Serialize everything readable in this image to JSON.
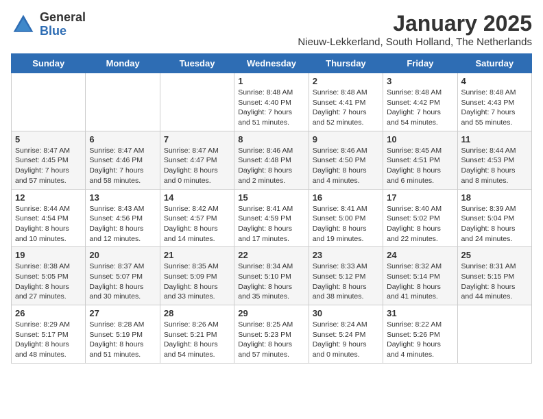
{
  "logo": {
    "general": "General",
    "blue": "Blue"
  },
  "title": "January 2025",
  "subtitle": "Nieuw-Lekkerland, South Holland, The Netherlands",
  "weekdays": [
    "Sunday",
    "Monday",
    "Tuesday",
    "Wednesday",
    "Thursday",
    "Friday",
    "Saturday"
  ],
  "weeks": [
    [
      {
        "day": "",
        "info": ""
      },
      {
        "day": "",
        "info": ""
      },
      {
        "day": "",
        "info": ""
      },
      {
        "day": "1",
        "info": "Sunrise: 8:48 AM\nSunset: 4:40 PM\nDaylight: 7 hours and 51 minutes."
      },
      {
        "day": "2",
        "info": "Sunrise: 8:48 AM\nSunset: 4:41 PM\nDaylight: 7 hours and 52 minutes."
      },
      {
        "day": "3",
        "info": "Sunrise: 8:48 AM\nSunset: 4:42 PM\nDaylight: 7 hours and 54 minutes."
      },
      {
        "day": "4",
        "info": "Sunrise: 8:48 AM\nSunset: 4:43 PM\nDaylight: 7 hours and 55 minutes."
      }
    ],
    [
      {
        "day": "5",
        "info": "Sunrise: 8:47 AM\nSunset: 4:45 PM\nDaylight: 7 hours and 57 minutes."
      },
      {
        "day": "6",
        "info": "Sunrise: 8:47 AM\nSunset: 4:46 PM\nDaylight: 7 hours and 58 minutes."
      },
      {
        "day": "7",
        "info": "Sunrise: 8:47 AM\nSunset: 4:47 PM\nDaylight: 8 hours and 0 minutes."
      },
      {
        "day": "8",
        "info": "Sunrise: 8:46 AM\nSunset: 4:48 PM\nDaylight: 8 hours and 2 minutes."
      },
      {
        "day": "9",
        "info": "Sunrise: 8:46 AM\nSunset: 4:50 PM\nDaylight: 8 hours and 4 minutes."
      },
      {
        "day": "10",
        "info": "Sunrise: 8:45 AM\nSunset: 4:51 PM\nDaylight: 8 hours and 6 minutes."
      },
      {
        "day": "11",
        "info": "Sunrise: 8:44 AM\nSunset: 4:53 PM\nDaylight: 8 hours and 8 minutes."
      }
    ],
    [
      {
        "day": "12",
        "info": "Sunrise: 8:44 AM\nSunset: 4:54 PM\nDaylight: 8 hours and 10 minutes."
      },
      {
        "day": "13",
        "info": "Sunrise: 8:43 AM\nSunset: 4:56 PM\nDaylight: 8 hours and 12 minutes."
      },
      {
        "day": "14",
        "info": "Sunrise: 8:42 AM\nSunset: 4:57 PM\nDaylight: 8 hours and 14 minutes."
      },
      {
        "day": "15",
        "info": "Sunrise: 8:41 AM\nSunset: 4:59 PM\nDaylight: 8 hours and 17 minutes."
      },
      {
        "day": "16",
        "info": "Sunrise: 8:41 AM\nSunset: 5:00 PM\nDaylight: 8 hours and 19 minutes."
      },
      {
        "day": "17",
        "info": "Sunrise: 8:40 AM\nSunset: 5:02 PM\nDaylight: 8 hours and 22 minutes."
      },
      {
        "day": "18",
        "info": "Sunrise: 8:39 AM\nSunset: 5:04 PM\nDaylight: 8 hours and 24 minutes."
      }
    ],
    [
      {
        "day": "19",
        "info": "Sunrise: 8:38 AM\nSunset: 5:05 PM\nDaylight: 8 hours and 27 minutes."
      },
      {
        "day": "20",
        "info": "Sunrise: 8:37 AM\nSunset: 5:07 PM\nDaylight: 8 hours and 30 minutes."
      },
      {
        "day": "21",
        "info": "Sunrise: 8:35 AM\nSunset: 5:09 PM\nDaylight: 8 hours and 33 minutes."
      },
      {
        "day": "22",
        "info": "Sunrise: 8:34 AM\nSunset: 5:10 PM\nDaylight: 8 hours and 35 minutes."
      },
      {
        "day": "23",
        "info": "Sunrise: 8:33 AM\nSunset: 5:12 PM\nDaylight: 8 hours and 38 minutes."
      },
      {
        "day": "24",
        "info": "Sunrise: 8:32 AM\nSunset: 5:14 PM\nDaylight: 8 hours and 41 minutes."
      },
      {
        "day": "25",
        "info": "Sunrise: 8:31 AM\nSunset: 5:15 PM\nDaylight: 8 hours and 44 minutes."
      }
    ],
    [
      {
        "day": "26",
        "info": "Sunrise: 8:29 AM\nSunset: 5:17 PM\nDaylight: 8 hours and 48 minutes."
      },
      {
        "day": "27",
        "info": "Sunrise: 8:28 AM\nSunset: 5:19 PM\nDaylight: 8 hours and 51 minutes."
      },
      {
        "day": "28",
        "info": "Sunrise: 8:26 AM\nSunset: 5:21 PM\nDaylight: 8 hours and 54 minutes."
      },
      {
        "day": "29",
        "info": "Sunrise: 8:25 AM\nSunset: 5:23 PM\nDaylight: 8 hours and 57 minutes."
      },
      {
        "day": "30",
        "info": "Sunrise: 8:24 AM\nSunset: 5:24 PM\nDaylight: 9 hours and 0 minutes."
      },
      {
        "day": "31",
        "info": "Sunrise: 8:22 AM\nSunset: 5:26 PM\nDaylight: 9 hours and 4 minutes."
      },
      {
        "day": "",
        "info": ""
      }
    ]
  ]
}
